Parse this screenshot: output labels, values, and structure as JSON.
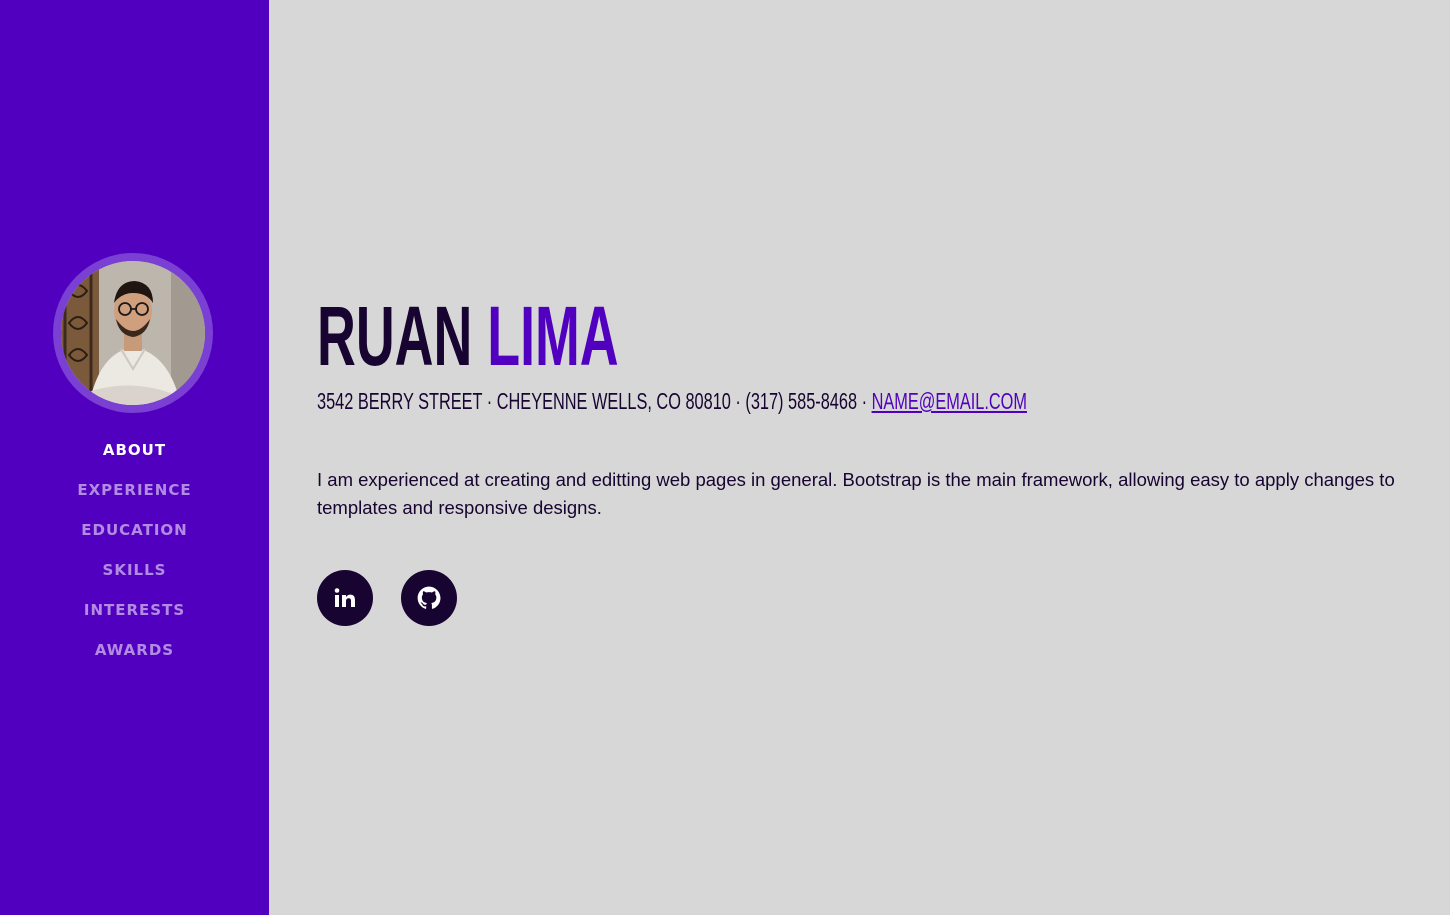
{
  "sidebar": {
    "nav": [
      {
        "label": "ABOUT",
        "active": true
      },
      {
        "label": "EXPERIENCE",
        "active": false
      },
      {
        "label": "EDUCATION",
        "active": false
      },
      {
        "label": "SKILLS",
        "active": false
      },
      {
        "label": "INTERESTS",
        "active": false
      },
      {
        "label": "AWARDS",
        "active": false
      }
    ]
  },
  "header": {
    "first_name": "RUAN",
    "last_name": "LIMA",
    "contact": {
      "address": "3542 Berry Street · Cheyenne Wells, CO 80810 · (317) 585-8468 · ",
      "email": "name@email.com"
    }
  },
  "about": {
    "text": "I am experienced at creating and editting web pages in general. Bootstrap is the main framework, allowing easy to apply changes to templates and responsive designs."
  },
  "social": [
    {
      "icon": "linkedin-icon"
    },
    {
      "icon": "github-icon"
    }
  ],
  "colors": {
    "sidebar": "#5200bf",
    "accent": "#5200bf",
    "dark": "#170430",
    "background": "#d7d7d7"
  }
}
